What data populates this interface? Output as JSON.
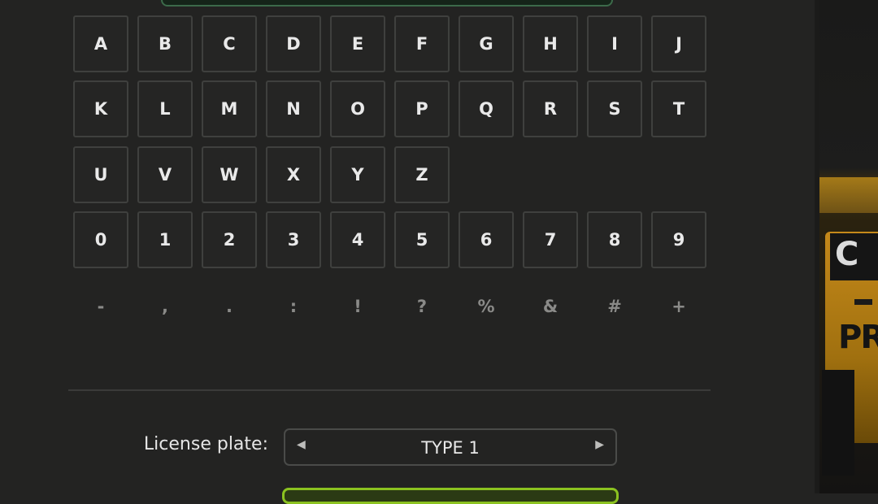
{
  "keyboard": {
    "rows": [
      [
        "A",
        "B",
        "C",
        "D",
        "E",
        "F",
        "G",
        "H",
        "I",
        "J"
      ],
      [
        "K",
        "L",
        "M",
        "N",
        "O",
        "P",
        "Q",
        "R",
        "S",
        "T"
      ],
      [
        "U",
        "V",
        "W",
        "X",
        "Y",
        "Z"
      ],
      [
        "0",
        "1",
        "2",
        "3",
        "4",
        "5",
        "6",
        "7",
        "8",
        "9"
      ]
    ],
    "symbols": [
      "-",
      ",",
      ".",
      ":",
      "!",
      "?",
      "%",
      "&",
      "#",
      "+"
    ]
  },
  "plate_settings": {
    "label": "License plate:",
    "value": "TYPE 1",
    "prev_icon": "left-triangle-icon",
    "next_icon": "right-triangle-icon"
  },
  "background": {
    "brand_fragment_1": "C",
    "brand_fragment_2": "PR"
  },
  "colors": {
    "accent": "#8bc220",
    "panel": "#232322",
    "key_border": "#3f403e"
  }
}
